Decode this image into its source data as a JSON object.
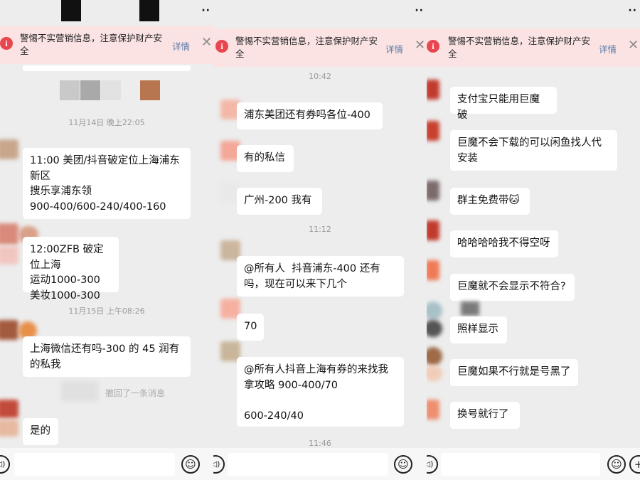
{
  "warning": {
    "text": "警惕不实营销信息，注意保护财产安全",
    "link": "详情",
    "close": "✕",
    "info": "i"
  },
  "more": "··",
  "emoji_icon": "☺",
  "voice_icon": "◁)",
  "plus_icon": "+",
  "panel1": {
    "timestamps": [
      "11月14日 晚上22:05",
      "11月15日 上午08:26"
    ],
    "messages": [
      "11:00 美团/抖音破定位上海浦东新区\n搜乐享浦东领\n900-400/600-240/400-160",
      "12:00ZFB 破定位上海\n运动1000-300\n美妆1000-300",
      "上海微信还有吗-300 的 45 润有的私我",
      "是的"
    ],
    "recall": "撤回了一条消息"
  },
  "panel2": {
    "timestamps": [
      "10:42",
      "11:12",
      "11:46"
    ],
    "messages": [
      "浦东美团还有券吗各位-400",
      "有的私信",
      "广州-200 我有",
      "@所有人  抖音浦东-400 还有吗，现在可以来下几个",
      "70",
      "@所有人抖音上海有券的来找我拿攻略 900-400/70\n\n600-240/40"
    ]
  },
  "panel3": {
    "messages": [
      "支付宝只能用巨魔破",
      "巨魔不会下载的可以闲鱼找人代安装",
      "群主免费带🐱",
      "哈哈哈哈我不得空呀",
      "巨魔就不会显示不符合?",
      "照样显示",
      "巨魔如果不行就是号黑了",
      "换号就行了"
    ]
  },
  "colors": {
    "background": "#ededed",
    "warning_bg": "#fbe3e4",
    "warning_icon": "#e8474f",
    "link": "#5a7aa8",
    "bubble": "#ffffff"
  }
}
